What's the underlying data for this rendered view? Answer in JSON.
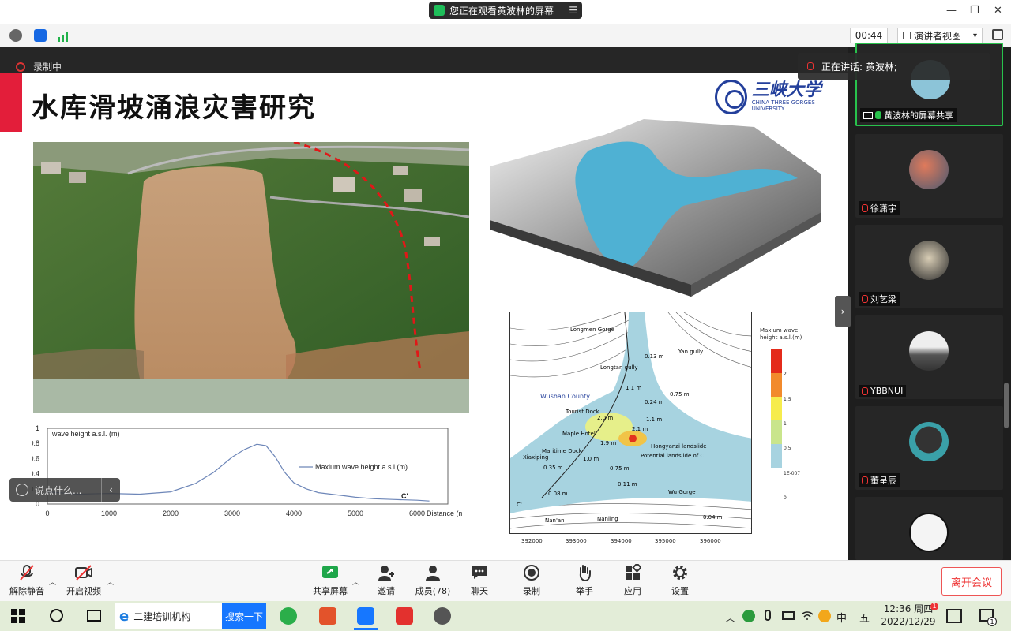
{
  "titlebar": {
    "share_notice": "您正在观看黄波林的屏幕",
    "menu_glyph": "☰",
    "minimize": "—",
    "restore": "❐",
    "close": "✕"
  },
  "toolbar": {
    "timer": "00:44",
    "view_label": "演讲者视图",
    "view_caret": "▾"
  },
  "recording_label": "录制中",
  "speaking_label": "正在讲话: 黄波林;",
  "slide": {
    "title": "水库滑坡涌浪灾害研究",
    "logo_text": "三峡大学",
    "logo_subtext": "CHINA THREE GORGES UNIVERSITY"
  },
  "map": {
    "labels": [
      "Longmen Gorge",
      "Longtan gully",
      "Yan gully",
      "Wushan County",
      "Tourist Dock",
      "Maple Hotel",
      "Maritime Dock",
      "Xiaxiping",
      "Hongyanzi landslide",
      "Potential landslide of C",
      "Wu Gorge",
      "Nan'an",
      "Nanling",
      "C'"
    ],
    "values": [
      "0.13 m",
      "1.1 m",
      "0.75 m",
      "0.24 m",
      "2.0 m",
      "1.1 m",
      "2.1 m",
      "1.9 m",
      "1.0 m",
      "0.35 m",
      "0.75 m",
      "0.11 m",
      "0.08 m",
      "0.04 m"
    ],
    "legend_title": "Maxium wave height a.s.l.(m)",
    "legend_ticks": [
      "2",
      "1.5",
      "1",
      "0.5",
      "1E-007",
      "0"
    ],
    "x_ticks": [
      "392000",
      "393000",
      "394000",
      "395000",
      "396000"
    ]
  },
  "chart_data": {
    "type": "line",
    "title": "wave height a.s.l. (m)",
    "xlabel": "Distance (m)",
    "ylabel": "",
    "xlim": [
      0,
      6500
    ],
    "ylim": [
      0,
      1
    ],
    "x_ticks": [
      "0",
      "1000",
      "2000",
      "3000",
      "4000",
      "5000",
      "6000"
    ],
    "y_ticks": [
      "0",
      "0.2",
      "0.4",
      "0.6",
      "0.8",
      "1"
    ],
    "end_label": "C'",
    "series": [
      {
        "name": "Maxium wave height a.s.l.(m)",
        "x": [
          0,
          500,
          1000,
          1500,
          2000,
          2400,
          2700,
          3000,
          3200,
          3400,
          3550,
          3700,
          3850,
          4000,
          4200,
          4400,
          4600,
          4800,
          5000,
          5300,
          5600,
          6000,
          6200
        ],
        "y": [
          0.16,
          0.13,
          0.14,
          0.13,
          0.16,
          0.27,
          0.42,
          0.62,
          0.72,
          0.79,
          0.77,
          0.62,
          0.42,
          0.28,
          0.2,
          0.15,
          0.13,
          0.11,
          0.09,
          0.07,
          0.06,
          0.05,
          0.04
        ]
      }
    ]
  },
  "participants": [
    {
      "name": "黄波林的屏幕共享",
      "mic": "green",
      "active": true
    },
    {
      "name": "徐潇宇",
      "mic": "muted"
    },
    {
      "name": "刘艺梁",
      "mic": "muted"
    },
    {
      "name": "YBBNUI",
      "mic": "muted"
    },
    {
      "name": "董呈辰",
      "mic": "muted"
    }
  ],
  "chat": {
    "placeholder": "说点什么...",
    "collapse": "‹"
  },
  "controls": {
    "unmute": "解除静音",
    "start_video": "开启视频",
    "share_screen": "共享屏幕",
    "invite": "邀请",
    "members": "成员(78)",
    "chat": "聊天",
    "record": "录制",
    "raise_hand": "举手",
    "apps": "应用",
    "settings": "设置",
    "leave": "离开会议"
  },
  "taskbar": {
    "browser_tab": "二建培训机构",
    "search_button": "搜索一下",
    "ime_lang": "中",
    "ime_mode": "五",
    "time": "12:36 周四",
    "date": "2022/12/29",
    "notification_badge": "1",
    "message_badge": "1"
  },
  "colors": {
    "accent_red": "#e31e3a",
    "brand_blue": "#233f9b",
    "active_green": "#28c24c",
    "leave_red": "#e33333"
  }
}
